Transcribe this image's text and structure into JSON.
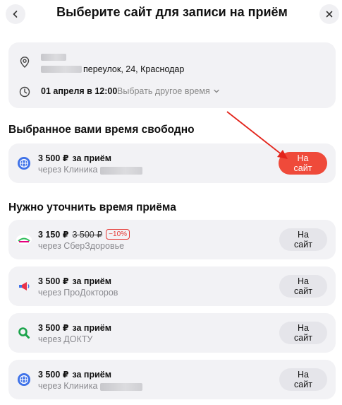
{
  "header": {
    "title": "Выберите сайт для записи на приём",
    "back_icon": "chevron-left-icon",
    "close_icon": "close-icon"
  },
  "info": {
    "address": "переулок, 24, Краснодар",
    "time": "01 апреля в 12:00",
    "change_time": "Выбрать другое время"
  },
  "sections": {
    "free": "Выбранное вами время свободно",
    "clarify": "Нужно уточнить время приёма"
  },
  "free_clinic": {
    "price": "3 500 ₽",
    "per": "за приём",
    "via": "через Клиника",
    "button": "На сайт"
  },
  "clinics": [
    {
      "price": "3 150 ₽",
      "old_price": "3 500 ₽",
      "discount": "−10%",
      "via": "через СберЗдоровье",
      "button": "На сайт"
    },
    {
      "price": "3 500 ₽",
      "per": "за приём",
      "via": "через ПроДокторов",
      "button": "На сайт"
    },
    {
      "price": "3 500 ₽",
      "per": "за приём",
      "via": "через ДОКТУ",
      "button": "На сайт"
    },
    {
      "price": "3 500 ₽",
      "per": "за приём",
      "via": "через Клиника",
      "button": "На сайт"
    }
  ],
  "colors": {
    "accent": "#ef4a3a",
    "card_bg": "#f2f2f5",
    "muted_text": "#8a8a8f"
  }
}
